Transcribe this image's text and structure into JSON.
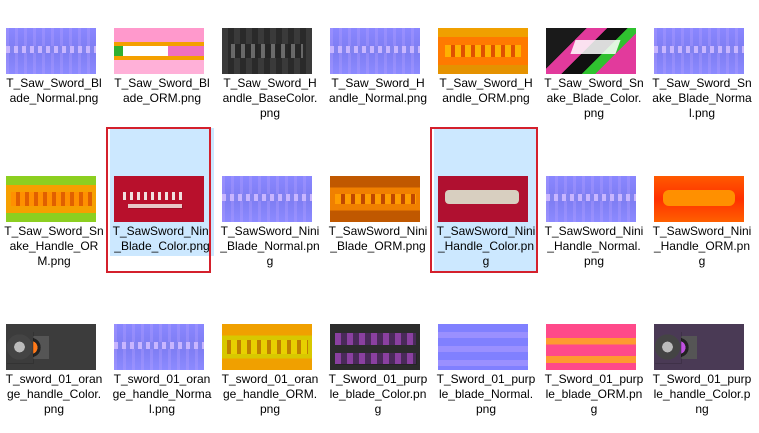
{
  "files": [
    {
      "name": "T_Saw_Sword_Blade_Normal.png",
      "thumb_icon": "normal-map-thumbnail",
      "selected": false
    },
    {
      "name": "T_Saw_Sword_Blade_ORM.png",
      "thumb_icon": "orm-map-thumbnail",
      "selected": false
    },
    {
      "name": "T_Saw_Sword_Handle_BaseColor.png",
      "thumb_icon": "basecolor-thumbnail",
      "selected": false
    },
    {
      "name": "T_Saw_Sword_Handle_Normal.png",
      "thumb_icon": "normal-map-thumbnail",
      "selected": false
    },
    {
      "name": "T_Saw_Sword_Handle_ORM.png",
      "thumb_icon": "orm-map-thumbnail",
      "selected": false
    },
    {
      "name": "T_Saw_Sword_Snake_Blade_Color.png",
      "thumb_icon": "color-map-thumbnail",
      "selected": false
    },
    {
      "name": "T_Saw_Sword_Snake_Blade_Normal.png",
      "thumb_icon": "normal-map-thumbnail",
      "selected": false
    },
    {
      "name": "T_Saw_Sword_Snake_Handle_ORM.png",
      "thumb_icon": "orm-map-thumbnail",
      "selected": false
    },
    {
      "name": "T_SawSword_Nini_Blade_Color.png",
      "thumb_icon": "color-map-thumbnail",
      "selected": true
    },
    {
      "name": "T_SawSword_Nini_Blade_Normal.png",
      "thumb_icon": "normal-map-thumbnail",
      "selected": false
    },
    {
      "name": "T_SawSword_Nini_Blade_ORM.png",
      "thumb_icon": "orm-map-thumbnail",
      "selected": false
    },
    {
      "name": "T_SawSword_Nini_Handle_Color.png",
      "thumb_icon": "color-map-thumbnail",
      "selected": true
    },
    {
      "name": "T_SawSword_Nini_Handle_Normal.png",
      "thumb_icon": "normal-map-thumbnail",
      "selected": false
    },
    {
      "name": "T_SawSword_Nini_Handle_ORM.png",
      "thumb_icon": "orm-map-thumbnail",
      "selected": false
    },
    {
      "name": "T_sword_01_orange_handle_Color.png",
      "thumb_icon": "color-map-thumbnail",
      "selected": false
    },
    {
      "name": "T_sword_01_orange_handle_Normal.png",
      "thumb_icon": "normal-map-thumbnail",
      "selected": false
    },
    {
      "name": "T_sword_01_orange_handle_ORM.png",
      "thumb_icon": "orm-map-thumbnail",
      "selected": false
    },
    {
      "name": "T_Sword_01_purple_blade_Color.png",
      "thumb_icon": "color-map-thumbnail",
      "selected": false
    },
    {
      "name": "T_Sword_01_purple_blade_Normal.png",
      "thumb_icon": "normal-map-thumbnail",
      "selected": false
    },
    {
      "name": "T_Sword_01_purple_blade_ORM.png",
      "thumb_icon": "orm-map-thumbnail",
      "selected": false
    },
    {
      "name": "T_Sword_01_purple_handle_Color.png",
      "thumb_icon": "color-map-thumbnail",
      "selected": false
    }
  ],
  "colors": {
    "selection_bg": "#cce8ff",
    "highlight_border": "#d4202c"
  }
}
